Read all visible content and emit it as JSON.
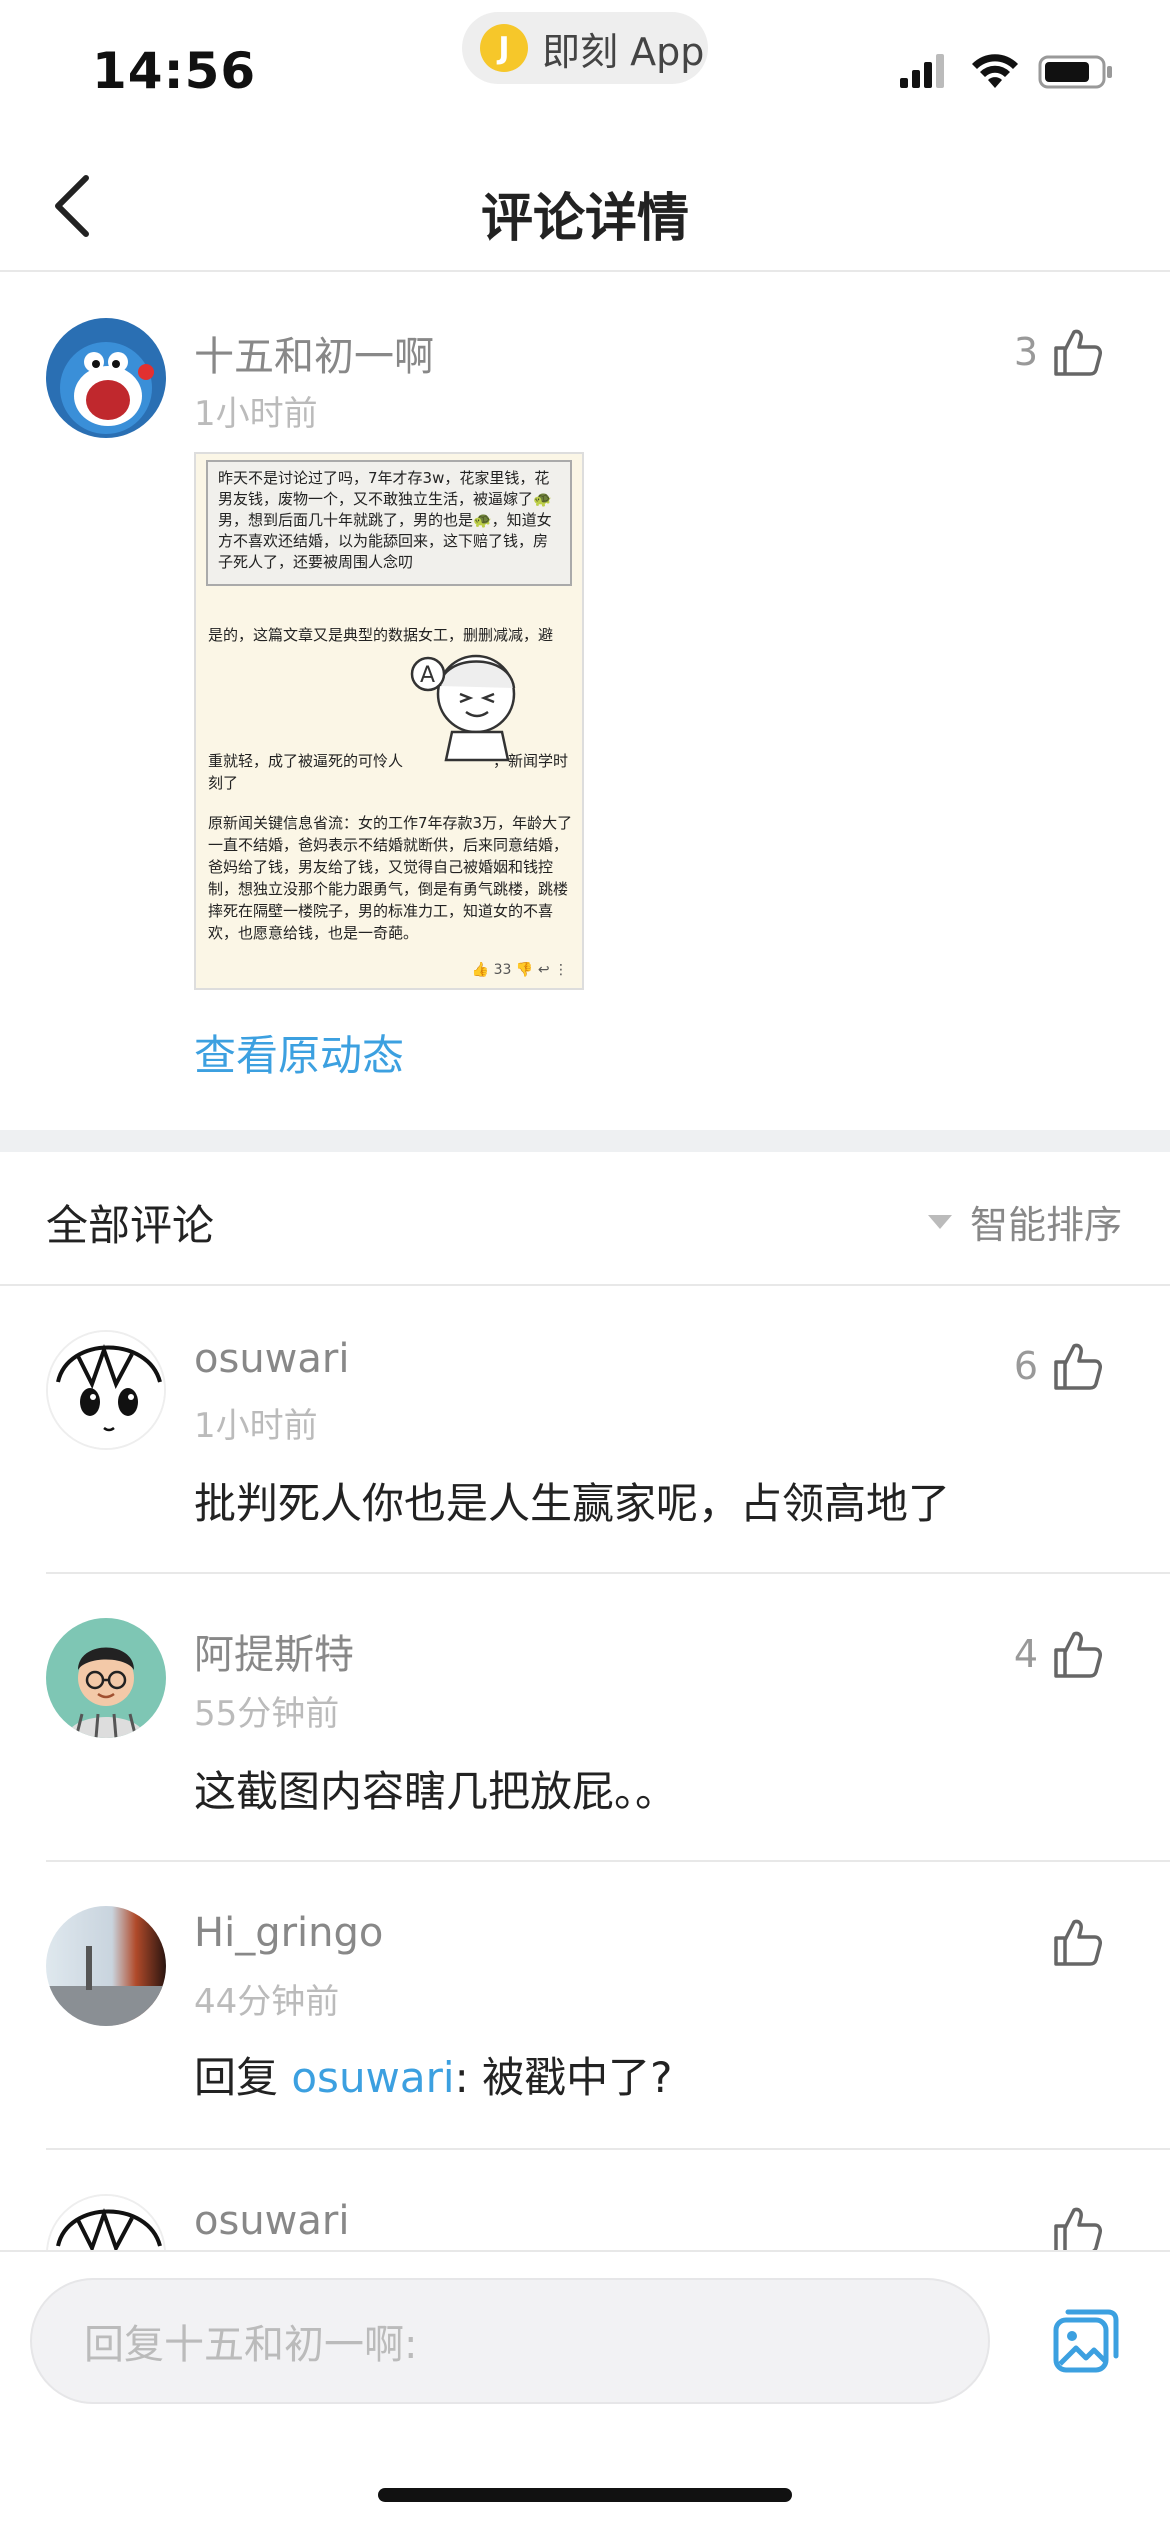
{
  "status_bar": {
    "time": "14:56",
    "app_name": "即刻 App"
  },
  "nav": {
    "title": "评论详情"
  },
  "main_comment": {
    "username": "十五和初一啊",
    "time": "1小时前",
    "likes": "3",
    "image_text": {
      "quote": "昨天不是讨论过了吗，7年才存3w，花家里钱，花男友钱，废物一个，又不敢独立生活，被逼嫁了🐢男，想到后面几十年就跳了，男的也是🐢，知道女方不喜欢还结婚，以为能舔回来，这下赔了钱，房子死人了，还要被周围人念叨",
      "para1": "是的，这篇文章又是典型的数据女工，删删减减，避",
      "para2": "重就轻，成了被逼死的可怜人　　　　　　，新闻学时刻了",
      "para3": "原新闻关键信息省流：女的工作7年存款3万，年龄大了一直不结婚，爸妈表示不结婚就断供，后来同意结婚，爸妈给了钱，男友给了钱，又觉得自己被婚姻和钱控制，想独立没那个能力跟勇气，倒是有勇气跳楼，跳楼摔死在隔壁一楼院子，男的标准力工，知道女的不喜欢，也愿意给钱，也是一奇葩。",
      "footer": "33"
    },
    "view_original": "查看原动态"
  },
  "comments_section": {
    "header": "全部评论",
    "sort_label": "智能排序"
  },
  "comments": [
    {
      "username": "osuwari",
      "time": "1小时前",
      "likes": "6",
      "text": "批判死人你也是人生赢家呢，占领高地了"
    },
    {
      "username": "阿提斯特",
      "time": "55分钟前",
      "likes": "4",
      "text": "这截图内容瞎几把放屁。。"
    },
    {
      "username": "Hi_gringo",
      "time": "44分钟前",
      "likes": "",
      "reply_prefix": "回复 ",
      "reply_to": "osuwari",
      "text": ": 被戳中了?"
    },
    {
      "username": "osuwari"
    }
  ],
  "bottom_bar": {
    "reply_placeholder": "回复十五和初一啊:"
  },
  "colors": {
    "accent": "#3ca0e0",
    "muted": "#888888"
  }
}
